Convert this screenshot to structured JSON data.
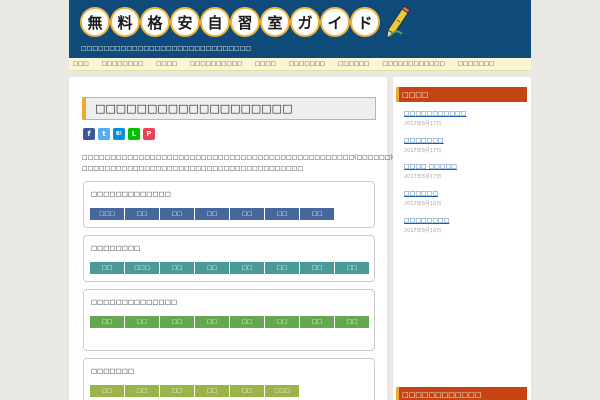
{
  "header": {
    "logo_chars": [
      "無",
      "料",
      "格",
      "安",
      "自",
      "習",
      "室",
      "ガ",
      "イ",
      "ド"
    ],
    "tagline": "□□□□□□□□□□□□□□□□□□□□□□□□□□□□□□",
    "colors": {
      "header_bg": "#0e4a7a",
      "ring": "#f2b33a",
      "accent": "#f0a82f",
      "sidebar_head": "#c44513"
    }
  },
  "nav": {
    "items": [
      "□□□",
      "□□□□□□□□",
      "□□□□",
      "□□□□□□□□□□",
      "□□□□",
      "□□□□□□□",
      "□□□□□□",
      "□□□□□□□□□□□□",
      "□□□□□□□"
    ]
  },
  "main": {
    "title": "□□□□□□□□□□□□□□□□□□□",
    "share_buttons": [
      "f",
      "t",
      "B!",
      "L",
      "P"
    ],
    "intro_lines": [
      "□□□□□□□□□□□□□□□□□□□□□□□□□□□□□□□□□□□□□□□□□□□□□□□□(□□□□□□)□□□□□□□□□□□□□□□□",
      "□□□□□□□□□□□□□□□□□□□□□□□□□□□□□□□□□□□□□□□"
    ],
    "boxes": [
      {
        "title": "□□□□□□□□□□□□□",
        "chips": [
          "□□□",
          "□□",
          "□□",
          "□□",
          "□□",
          "□□",
          "□□"
        ],
        "color": "#46679e"
      },
      {
        "title": "□□□□□□□□",
        "chips": [
          "□□",
          "□□□",
          "□□",
          "□□",
          "□□",
          "□□",
          "□□",
          "□□"
        ],
        "color": "#4a9a98"
      },
      {
        "title": "□□□□□□□□□□□□□□",
        "chips": [
          "□□",
          "□□",
          "□□",
          "□□",
          "□□",
          "□□",
          "□□",
          "□□"
        ],
        "color": "#64a84f"
      },
      {
        "title": "□□□□□□□",
        "chips": [
          "□□",
          "□□",
          "□□",
          "□□",
          "□□",
          "□□□"
        ],
        "color": "#99b549"
      }
    ]
  },
  "sidebar": {
    "recent_heading": "□□□□",
    "recent_posts": [
      {
        "title": "□□□□□□□□□□□",
        "date": "2017年8月17日"
      },
      {
        "title": "□□□□□□□",
        "date": "2017年8月17日"
      },
      {
        "title": "□□□□ □□□□□",
        "date": "2017年8月17日"
      },
      {
        "title": "□□□□□□",
        "date": "2017年8月16日"
      },
      {
        "title": "□□□□□□□□",
        "date": "2017年8月16日"
      }
    ],
    "second_heading": "□□□□□□□□□□□□"
  }
}
